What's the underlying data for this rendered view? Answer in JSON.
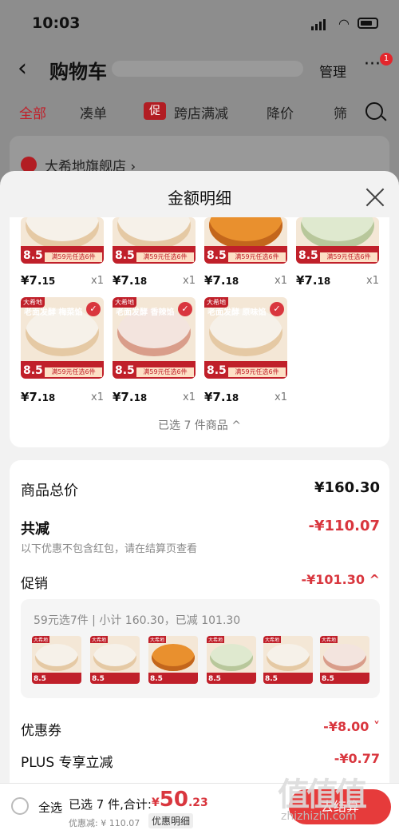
{
  "status_bar": {
    "time": "10:03"
  },
  "header": {
    "title": "购物车",
    "manage": "管理",
    "badge": "1"
  },
  "tabs": [
    {
      "label": "全部"
    },
    {
      "label": "凑单"
    },
    {
      "label": "跨店满减",
      "icon_text": "促"
    },
    {
      "label": "降价"
    },
    {
      "label": "筛"
    }
  ],
  "store": {
    "name": "大希地旗舰店 ›"
  },
  "sheet": {
    "title": "金额明细"
  },
  "products_row1": [
    {
      "price": "¥7.",
      "cents": "15",
      "qty": "x1"
    },
    {
      "price": "¥7.",
      "cents": "18",
      "qty": "x1"
    },
    {
      "price": "¥7.",
      "cents": "18",
      "qty": "x1"
    },
    {
      "price": "¥7.",
      "cents": "18",
      "qty": "x1"
    }
  ],
  "products_row2": [
    {
      "price": "¥7.",
      "cents": "18",
      "qty": "x1",
      "brand": "大希地",
      "tagline": "老面发酵 梅菜馅",
      "check": "✓"
    },
    {
      "price": "¥7.",
      "cents": "18",
      "qty": "x1",
      "brand": "大希地",
      "tagline": "老面发酵 香辣馅",
      "check": "✓"
    },
    {
      "price": "¥7.",
      "cents": "18",
      "qty": "x1",
      "brand": "大希地",
      "tagline": "老面发酵 原味馅",
      "check": "✓"
    }
  ],
  "thumb_common": {
    "price_big": "8.5",
    "deal": "满59元任选6件"
  },
  "selected_count": "已选 7 件商品 ^",
  "summary": {
    "total_label": "商品总价",
    "total_value": "¥160.30",
    "reduce_label": "共减",
    "reduce_value": "-¥110.07",
    "note": "以下优惠不包含红包，请在结算页查看",
    "promo_label": "促销",
    "promo_value": "-¥101.30 ^",
    "promo_detail": "59元选7件 | 小计 160.30，已减 101.30",
    "coupon_label": "优惠券",
    "coupon_value": "-¥8.00 ˅",
    "plus_label": "PLUS 专享立减",
    "plus_value": "-¥0.77"
  },
  "bottom_bar": {
    "select_all": "全选",
    "picked": "已选 7 件,合计:",
    "total_yen": "¥",
    "total_int": "50",
    "total_dec": ".23",
    "discount": "优惠减: ¥ 110.07",
    "detail": "优惠明细",
    "checkout": "去结算"
  },
  "watermark": {
    "main": "值值值",
    "site": "zhizhizhi.com"
  },
  "colors": {
    "accent": "#d9363e",
    "brand_red": "#c0202a"
  }
}
